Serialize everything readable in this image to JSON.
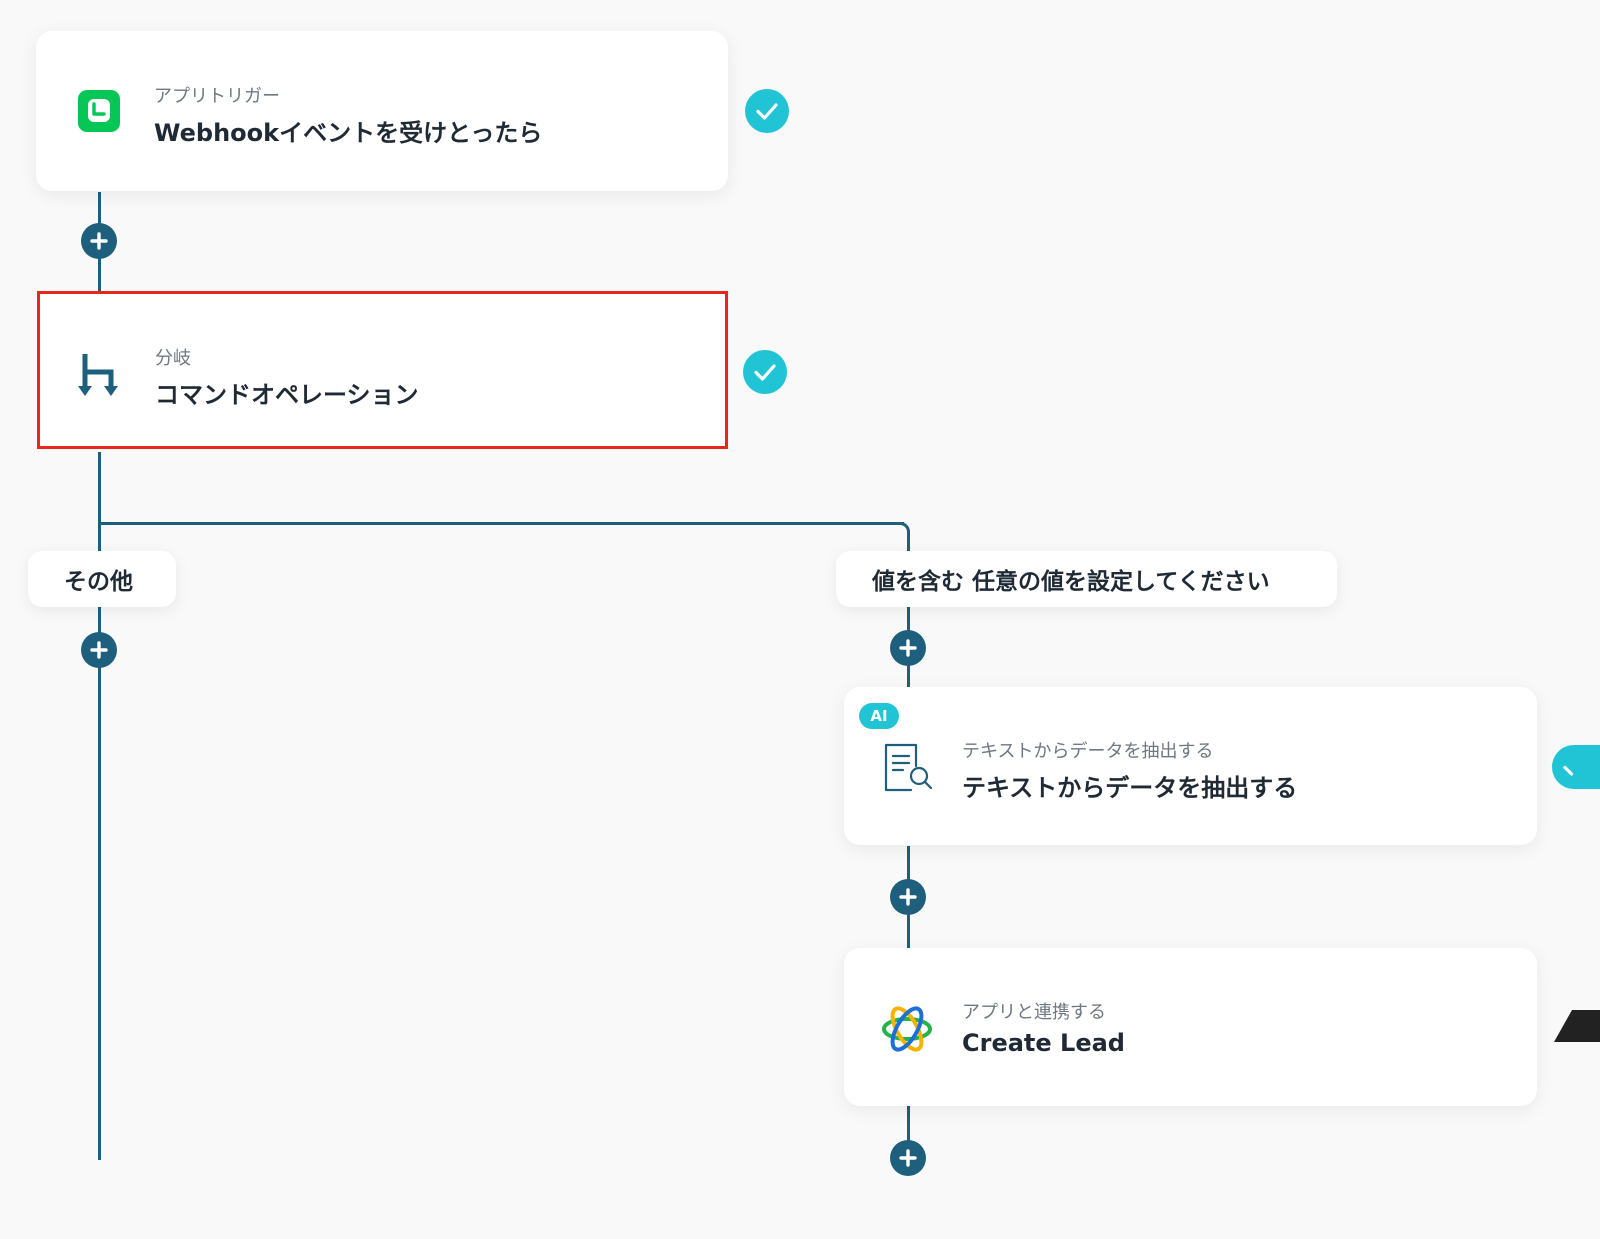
{
  "flow": {
    "trigger": {
      "subtitle": "アプリトリガー",
      "title": "Webhookイベントを受けとったら",
      "icon": "line-app-icon",
      "status": "completed"
    },
    "branch": {
      "subtitle": "分岐",
      "title": "コマンドオペレーション",
      "icon": "branch-icon",
      "status": "completed"
    },
    "branches": {
      "left": {
        "label": "その他"
      },
      "right": {
        "label": "値を含む 任意の値を設定してください"
      }
    },
    "extract": {
      "badge": "AI",
      "subtitle": "テキストからデータを抽出する",
      "title": "テキストからデータを抽出する",
      "icon": "document-search-icon",
      "status": "completed"
    },
    "create_lead": {
      "subtitle": "アプリと連携する",
      "title": "Create Lead",
      "icon": "atom-app-icon",
      "status": "warning"
    }
  },
  "colors": {
    "connector": "#1d5f7c",
    "check": "#21c4d4",
    "highlight": "#e8271c",
    "line_app": "#06c755"
  }
}
